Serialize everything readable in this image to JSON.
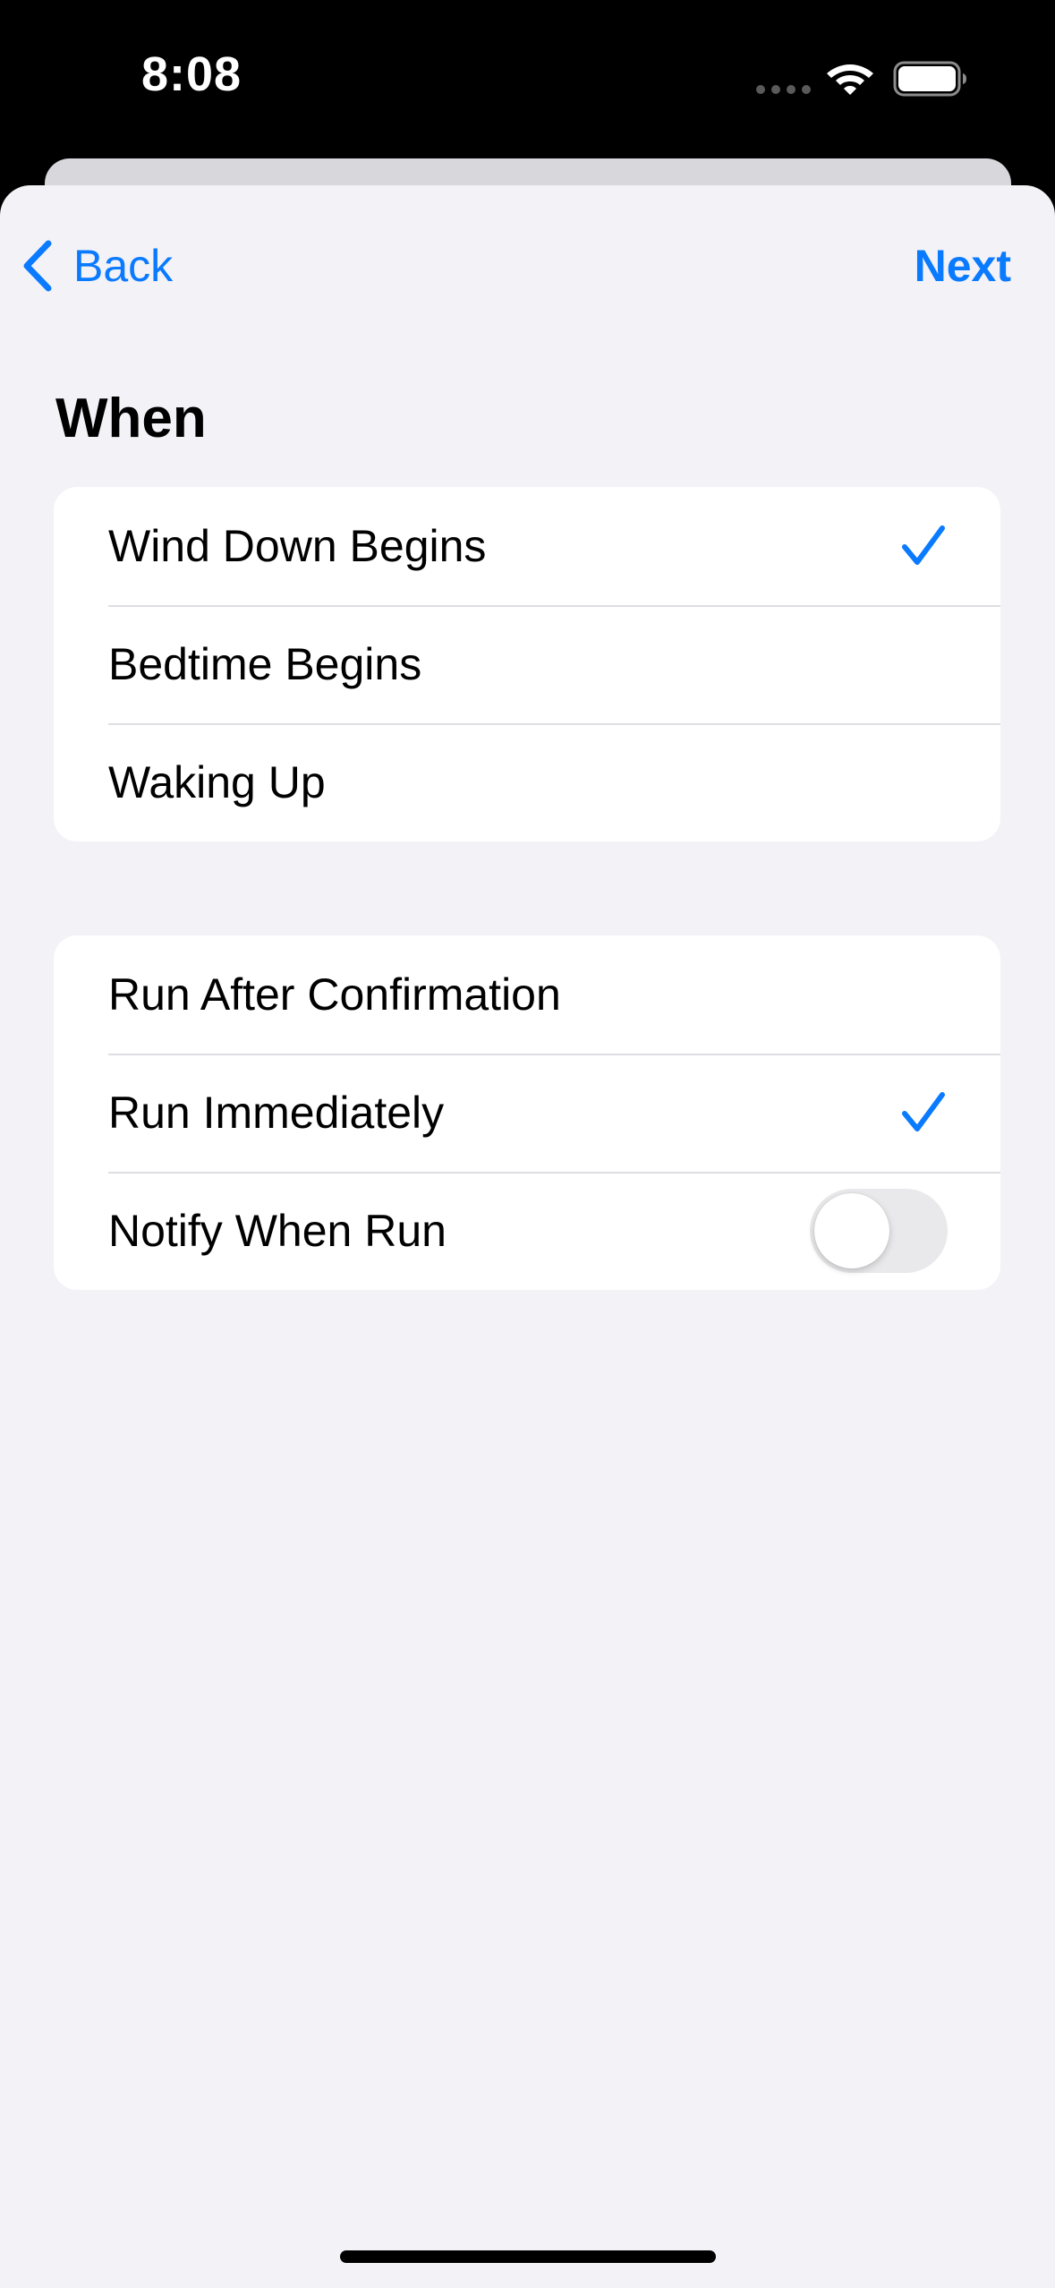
{
  "status_bar": {
    "time": "8:08",
    "icons": [
      "signal-dots-icon",
      "wifi-icon",
      "battery-icon"
    ]
  },
  "nav": {
    "back_label": "Back",
    "next_label": "Next"
  },
  "section": {
    "title": "When"
  },
  "when_options": [
    {
      "label": "Wind Down Begins",
      "selected": true
    },
    {
      "label": "Bedtime Begins",
      "selected": false
    },
    {
      "label": "Waking Up",
      "selected": false
    }
  ],
  "run_options": [
    {
      "label": "Run After Confirmation",
      "selected": false
    },
    {
      "label": "Run Immediately",
      "selected": true
    },
    {
      "label": "Notify When Run",
      "type": "toggle",
      "on": false
    }
  ],
  "colors": {
    "accent": "#0a7aff",
    "background": "#f2f2f7",
    "card": "#ffffff",
    "toggle_off": "#e9e9eb"
  }
}
